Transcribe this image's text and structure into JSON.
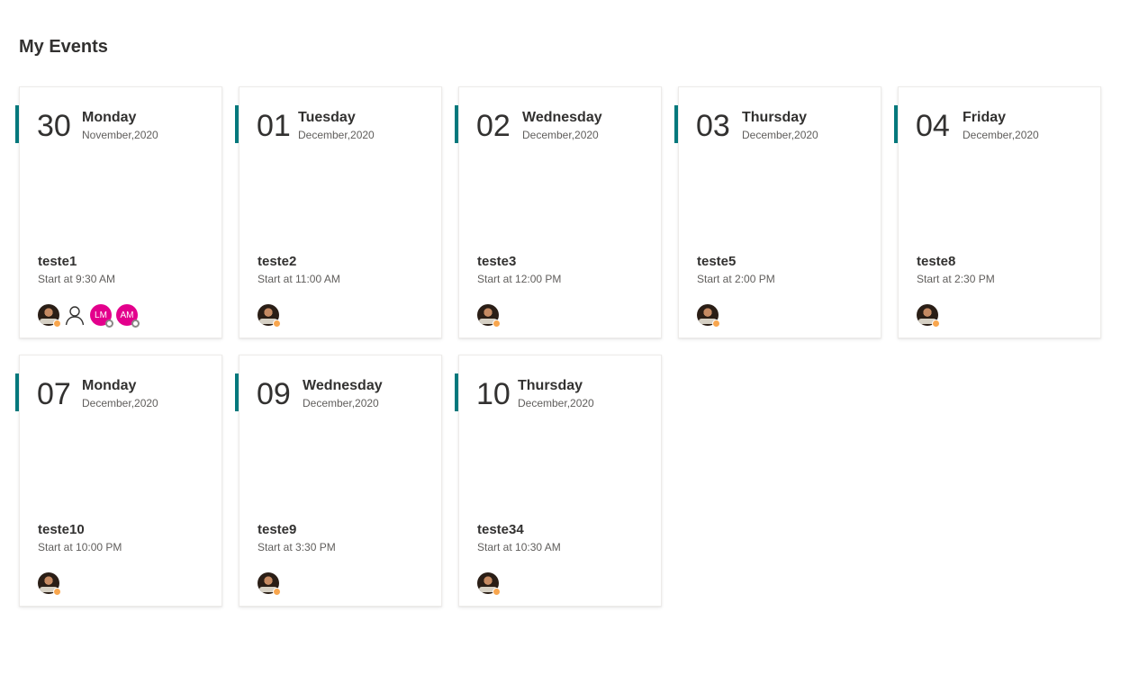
{
  "page": {
    "title": "My Events"
  },
  "colors": {
    "accent": "#03787c",
    "initials_bg": "#e3008c",
    "presence_away": "#f8a64e"
  },
  "events": [
    {
      "day": "30",
      "weekday": "Monday",
      "month_year": "November,2020",
      "title": "teste1",
      "start": "Start at 9:30 AM",
      "attendees": [
        {
          "type": "photo",
          "icon": "user-photo-avatar",
          "presence": "away"
        },
        {
          "type": "generic",
          "icon": "person-outline-icon"
        },
        {
          "type": "initials",
          "initials": "LM",
          "presence": "offline"
        },
        {
          "type": "initials",
          "initials": "AM",
          "presence": "offline"
        }
      ]
    },
    {
      "day": "01",
      "weekday": "Tuesday",
      "month_year": "December,2020",
      "title": "teste2",
      "start": "Start at 11:00 AM",
      "attendees": [
        {
          "type": "photo",
          "icon": "user-photo-avatar",
          "presence": "away"
        }
      ]
    },
    {
      "day": "02",
      "weekday": "Wednesday",
      "month_year": "December,2020",
      "title": "teste3",
      "start": "Start at 12:00 PM",
      "attendees": [
        {
          "type": "photo",
          "icon": "user-photo-avatar",
          "presence": "away"
        }
      ]
    },
    {
      "day": "03",
      "weekday": "Thursday",
      "month_year": "December,2020",
      "title": "teste5",
      "start": "Start at 2:00 PM",
      "attendees": [
        {
          "type": "photo",
          "icon": "user-photo-avatar",
          "presence": "away"
        }
      ]
    },
    {
      "day": "04",
      "weekday": "Friday",
      "month_year": "December,2020",
      "title": "teste8",
      "start": "Start at 2:30 PM",
      "attendees": [
        {
          "type": "photo",
          "icon": "user-photo-avatar",
          "presence": "away"
        }
      ]
    },
    {
      "day": "07",
      "weekday": "Monday",
      "month_year": "December,2020",
      "title": "teste10",
      "start": "Start at 10:00 PM",
      "attendees": [
        {
          "type": "photo",
          "icon": "user-photo-avatar",
          "presence": "away"
        }
      ]
    },
    {
      "day": "09",
      "weekday": "Wednesday",
      "month_year": "December,2020",
      "title": "teste9",
      "start": "Start at 3:30 PM",
      "attendees": [
        {
          "type": "photo",
          "icon": "user-photo-avatar",
          "presence": "away"
        }
      ]
    },
    {
      "day": "10",
      "weekday": "Thursday",
      "month_year": "December,2020",
      "title": "teste34",
      "start": "Start at 10:30 AM",
      "attendees": [
        {
          "type": "photo",
          "icon": "user-photo-avatar",
          "presence": "away"
        }
      ]
    }
  ]
}
